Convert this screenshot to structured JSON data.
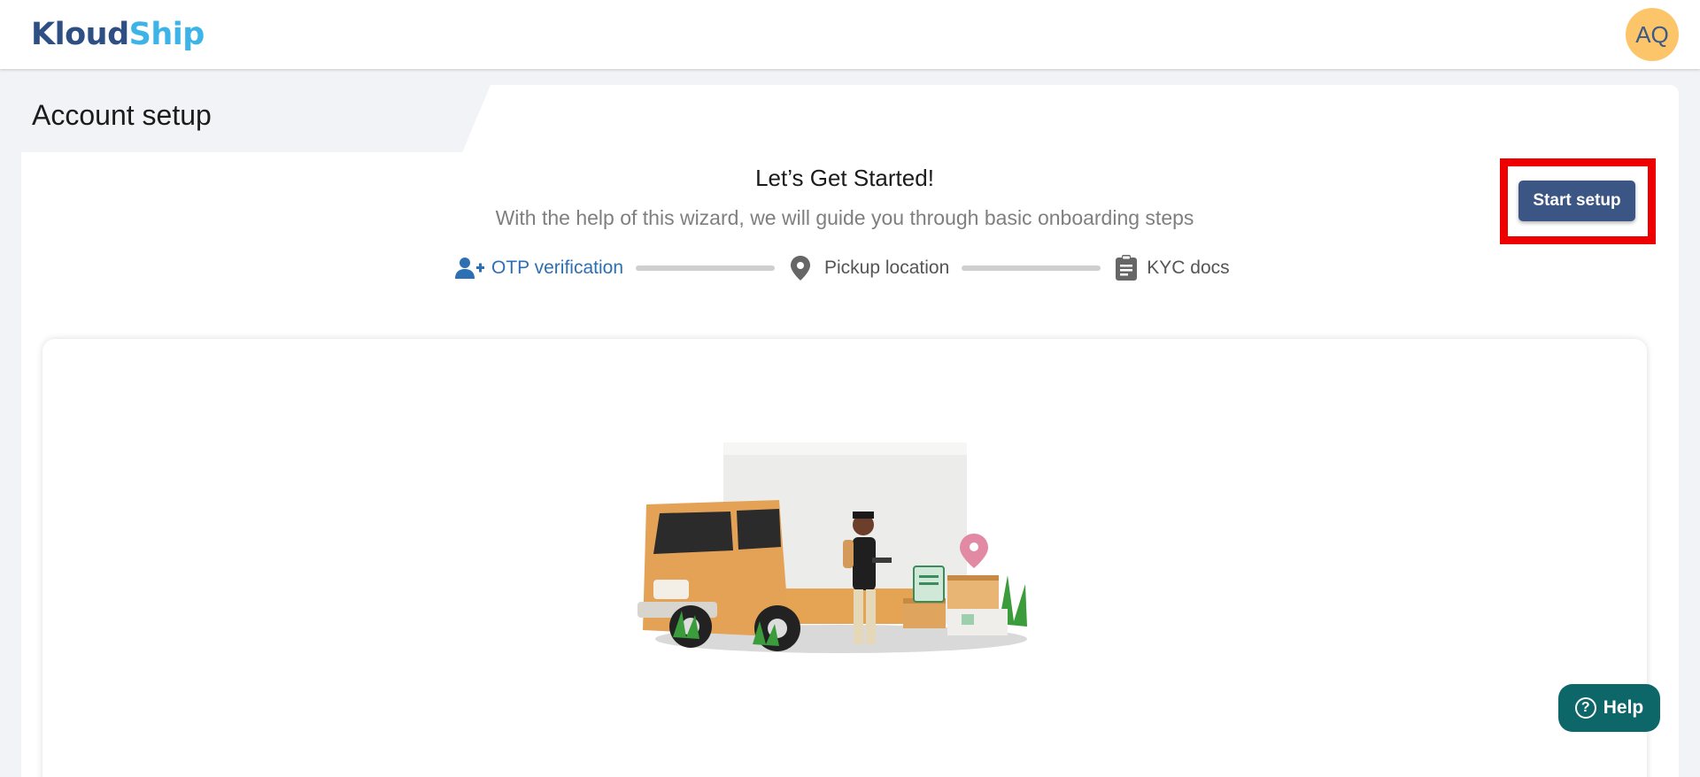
{
  "header": {
    "logo_part1": "Kloud",
    "logo_part2": "Ship",
    "avatar_initials": "AQ"
  },
  "page": {
    "title": "Account setup",
    "heading": "Let’s Get Started!",
    "subheading": "With the help of this wizard, we will guide you through basic onboarding steps"
  },
  "steps": [
    {
      "label": "OTP verification",
      "icon": "add-user-icon",
      "active": true
    },
    {
      "label": "Pickup location",
      "icon": "map-pin-icon",
      "active": false
    },
    {
      "label": "KYC docs",
      "icon": "clipboard-icon",
      "active": false
    }
  ],
  "actions": {
    "start_setup_label": "Start setup",
    "help_label": "Help",
    "help_icon_glyph": "?"
  },
  "colors": {
    "brand_dark": "#2e4f83",
    "brand_light": "#3db4e8",
    "active_step": "#2d6fb3",
    "primary_button": "#3b5584",
    "help_button": "#0d6668",
    "highlight": "#ee0000",
    "avatar_bg": "#fcc56a"
  }
}
